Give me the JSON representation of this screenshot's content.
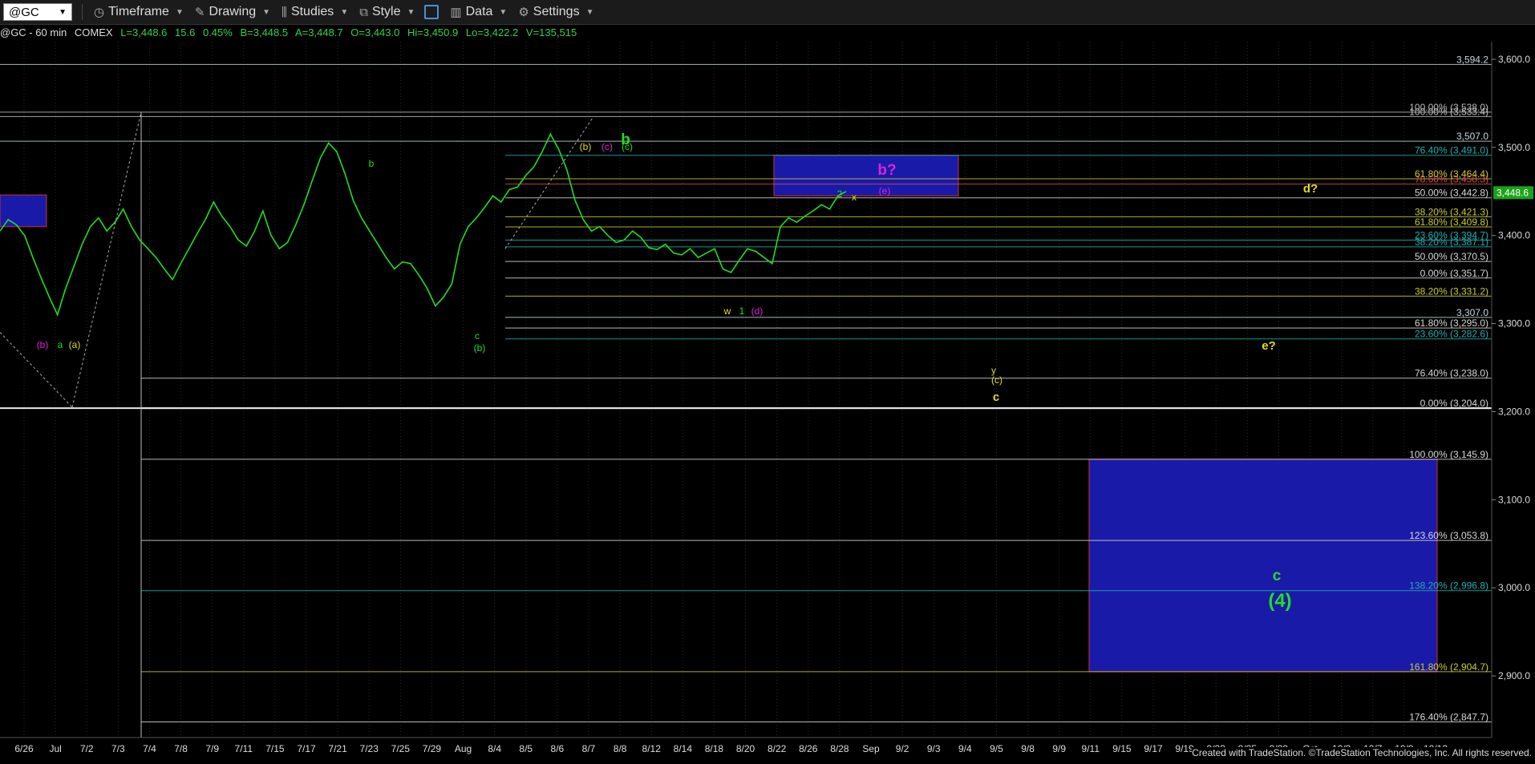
{
  "toolbar": {
    "symbol": "@GC",
    "items": [
      {
        "label": "Timeframe",
        "icon": "clock-icon"
      },
      {
        "label": "Drawing",
        "icon": "pencil-icon"
      },
      {
        "label": "Studies",
        "icon": "studies-icon"
      },
      {
        "label": "Style",
        "icon": "style-icon"
      },
      {
        "label": "Data",
        "icon": "bar-chart-icon"
      },
      {
        "label": "Settings",
        "icon": "gear-icon"
      }
    ]
  },
  "info_bar": {
    "symbol": "@GC - 60 min",
    "exchange": "COMEX",
    "last": "L=3,448.6",
    "change": "15.6",
    "pct": "0.45%",
    "bid": "B=3,448.5",
    "ask": "A=3,448.7",
    "open": "O=3,443.0",
    "high": "Hi=3,450.9",
    "low": "Lo=3,422.2",
    "volume": "V=135,515",
    "colors": {
      "label": "#dddddd",
      "value": "#37d04a"
    }
  },
  "footer": "Created with TradeStation. ©TradeStation Technologies, Inc. All rights reserved.",
  "chart_data": {
    "type": "line",
    "title": "",
    "ylim": [
      2830,
      3620
    ],
    "y_ticks": [
      "3,600.0",
      "3,500.0",
      "3,400.0",
      "3,300.0",
      "3,200.0",
      "3,100.0",
      "3,000.0",
      "2,900.0"
    ],
    "y_tick_values": [
      3600,
      3500,
      3400,
      3300,
      3200,
      3100,
      3000,
      2900
    ],
    "last_price_label": "3,448.6",
    "last_price": 3448.6,
    "x_labels": [
      "6/26",
      "Jul",
      "7/2",
      "7/3",
      "7/4",
      "7/8",
      "7/9",
      "7/11",
      "7/15",
      "7/17",
      "7/21",
      "7/23",
      "7/25",
      "7/29",
      "Aug",
      "8/4",
      "8/5",
      "8/6",
      "8/7",
      "8/8",
      "8/12",
      "8/14",
      "8/18",
      "8/20",
      "8/22",
      "8/26",
      "8/28",
      "Sep",
      "9/2",
      "9/3",
      "9/4",
      "9/5",
      "9/8",
      "9/9",
      "9/11",
      "9/15",
      "9/17",
      "9/19",
      "9/23",
      "9/25",
      "9/29",
      "Oct",
      "10/3",
      "10/7",
      "10/9",
      "10/13"
    ],
    "series": [
      {
        "color": "#22dd22",
        "values": [
          3405,
          3418,
          3412,
          3400,
          3375,
          3352,
          3330,
          3310,
          3340,
          3365,
          3390,
          3410,
          3420,
          3405,
          3415,
          3430,
          3410,
          3395,
          3385,
          3375,
          3362,
          3350,
          3368,
          3385,
          3402,
          3418,
          3438,
          3422,
          3410,
          3395,
          3388,
          3405,
          3428,
          3400,
          3385,
          3392,
          3412,
          3435,
          3462,
          3488,
          3505,
          3495,
          3470,
          3440,
          3420,
          3405,
          3390,
          3375,
          3362,
          3370,
          3368,
          3355,
          3340,
          3320,
          3330,
          3345,
          3390,
          3410,
          3420,
          3432,
          3445,
          3438,
          3452,
          3455,
          3468,
          3478,
          3495,
          3515,
          3498,
          3475,
          3440,
          3418,
          3405,
          3410,
          3400,
          3392,
          3395,
          3405,
          3398,
          3386,
          3384,
          3390,
          3380,
          3378,
          3385,
          3375,
          3380,
          3385,
          3362,
          3358,
          3372,
          3385,
          3382,
          3375,
          3368,
          3410,
          3420,
          3415,
          3422,
          3428,
          3435,
          3430,
          3445,
          3450
        ]
      }
    ],
    "horizontal_levels": [
      {
        "label": "3,594.2",
        "value": 3594.2,
        "color": "#c8d8e0"
      },
      {
        "label": "100.00% (3,538.0)",
        "value": 3540,
        "color": "#bbbbbb"
      },
      {
        "label": "100.00% (3,533.4)",
        "value": 3535,
        "color": "#bbbbbb"
      },
      {
        "label": "3,507.0",
        "value": 3507,
        "color": "#c8d8e0"
      },
      {
        "label": "76.40% (3,491.0)",
        "value": 3491,
        "color": "#20b0b0"
      },
      {
        "label": "61.80% (3,464.4)",
        "value": 3464.4,
        "color": "#cccc33"
      },
      {
        "label": "78.60% (3,458.3)",
        "value": 3458.3,
        "color": "#d05050"
      },
      {
        "label": "50.00% (3,442.8)",
        "value": 3442.8,
        "color": "#d8d8d8"
      },
      {
        "label": "38.20% (3,421.3)",
        "value": 3421.3,
        "color": "#cccc33"
      },
      {
        "label": "61.80% (3,409.8)",
        "value": 3409.8,
        "color": "#cccc33"
      },
      {
        "label": "23.60% (3,394.7)",
        "value": 3394.7,
        "color": "#20b0b0"
      },
      {
        "label": "38.20% (3,387.1)",
        "value": 3387.1,
        "color": "#20b0b0"
      },
      {
        "label": "50.00% (3,370.5)",
        "value": 3370.5,
        "color": "#d8d8d8"
      },
      {
        "label": "0.00% (3,351.7)",
        "value": 3351.7,
        "color": "#d8d8d8"
      },
      {
        "label": "38.20% (3,331.2)",
        "value": 3331.2,
        "color": "#cccc33"
      },
      {
        "label": "3,307.0",
        "value": 3307,
        "color": "#c8d8e0"
      },
      {
        "label": "61.80% (3,295.0)",
        "value": 3295,
        "color": "#d8d8d8"
      },
      {
        "label": "23.60% (3,282.6)",
        "value": 3282.6,
        "color": "#20b0b0"
      },
      {
        "label": "76.40% (3,238.0)",
        "value": 3238,
        "color": "#d8d8d8"
      },
      {
        "label": "0.00% (3,204.0)",
        "value": 3204,
        "color": "#d8d8d8"
      },
      {
        "label": "100.00% (3,145.9)",
        "value": 3145.9,
        "color": "#d8d8d8"
      },
      {
        "label": "123.60% (3,053.8)",
        "value": 3053.8,
        "color": "#d8d8d8"
      },
      {
        "label": "138.20% (2,996.8)",
        "value": 2996.8,
        "color": "#20b0b0"
      },
      {
        "label": "161.80% (2,904.7)",
        "value": 2904.7,
        "color": "#cccc33"
      },
      {
        "label": "176.40% (2,847.7)",
        "value": 2847.7,
        "color": "#d8d8d8"
      }
    ],
    "boxes": [
      {
        "name": "target-box-upper",
        "y1": 3491,
        "y2": 3445,
        "color": "#1a1aa8"
      },
      {
        "name": "target-box-lower",
        "y1": 3145.9,
        "y2": 2904.7,
        "color": "#1a1aa8"
      },
      {
        "name": "target-box-left",
        "y1": 3446,
        "y2": 3410,
        "color": "#1a1aa8"
      }
    ],
    "annotations": [
      {
        "text": "b",
        "color": "#22dd22",
        "size": 19,
        "bold": true
      },
      {
        "text": "b?",
        "color": "#dd22dd",
        "size": 19,
        "bold": true
      },
      {
        "text": "d?",
        "color": "#dddd22",
        "size": 15,
        "bold": true
      },
      {
        "text": "e?",
        "color": "#dddd22",
        "size": 15,
        "bold": true
      },
      {
        "text": "c",
        "color": "#dddd22",
        "size": 15,
        "bold": true
      },
      {
        "text": "c",
        "color": "#22dd22",
        "size": 19,
        "bold": true
      },
      {
        "text": "(4)",
        "color": "#22dd22",
        "size": 24,
        "bold": true
      },
      {
        "text": "(b)",
        "color": "#dddd22",
        "size": 12,
        "bold": false
      },
      {
        "text": "(c)",
        "color": "#dd22dd",
        "size": 12,
        "bold": false
      },
      {
        "text": "(c)",
        "color": "#22dd22",
        "size": 12,
        "bold": false
      },
      {
        "text": "b",
        "color": "#22dd22",
        "size": 12,
        "bold": false
      },
      {
        "text": "(b)",
        "color": "#dd22dd",
        "size": 12,
        "bold": false
      },
      {
        "text": "a",
        "color": "#22dd22",
        "size": 12,
        "bold": false
      },
      {
        "text": "(a)",
        "color": "#dddd22",
        "size": 12,
        "bold": false
      },
      {
        "text": "c",
        "color": "#22dd22",
        "size": 12,
        "bold": false
      },
      {
        "text": "(b)",
        "color": "#22dd22",
        "size": 12,
        "bold": false
      },
      {
        "text": "w",
        "color": "#dddd22",
        "size": 12,
        "bold": false
      },
      {
        "text": "1",
        "color": "#22dd22",
        "size": 12,
        "bold": false
      },
      {
        "text": "(d)",
        "color": "#dd22dd",
        "size": 12,
        "bold": false
      },
      {
        "text": "2",
        "color": "#22dd22",
        "size": 12,
        "bold": false
      },
      {
        "text": "x",
        "color": "#dddd22",
        "size": 12,
        "bold": false
      },
      {
        "text": "(e)",
        "color": "#dd22dd",
        "size": 12,
        "bold": false
      },
      {
        "text": "y",
        "color": "#dddd22",
        "size": 12,
        "bold": false
      },
      {
        "text": "(c)",
        "color": "#dddd22",
        "size": 12,
        "bold": false
      }
    ]
  }
}
